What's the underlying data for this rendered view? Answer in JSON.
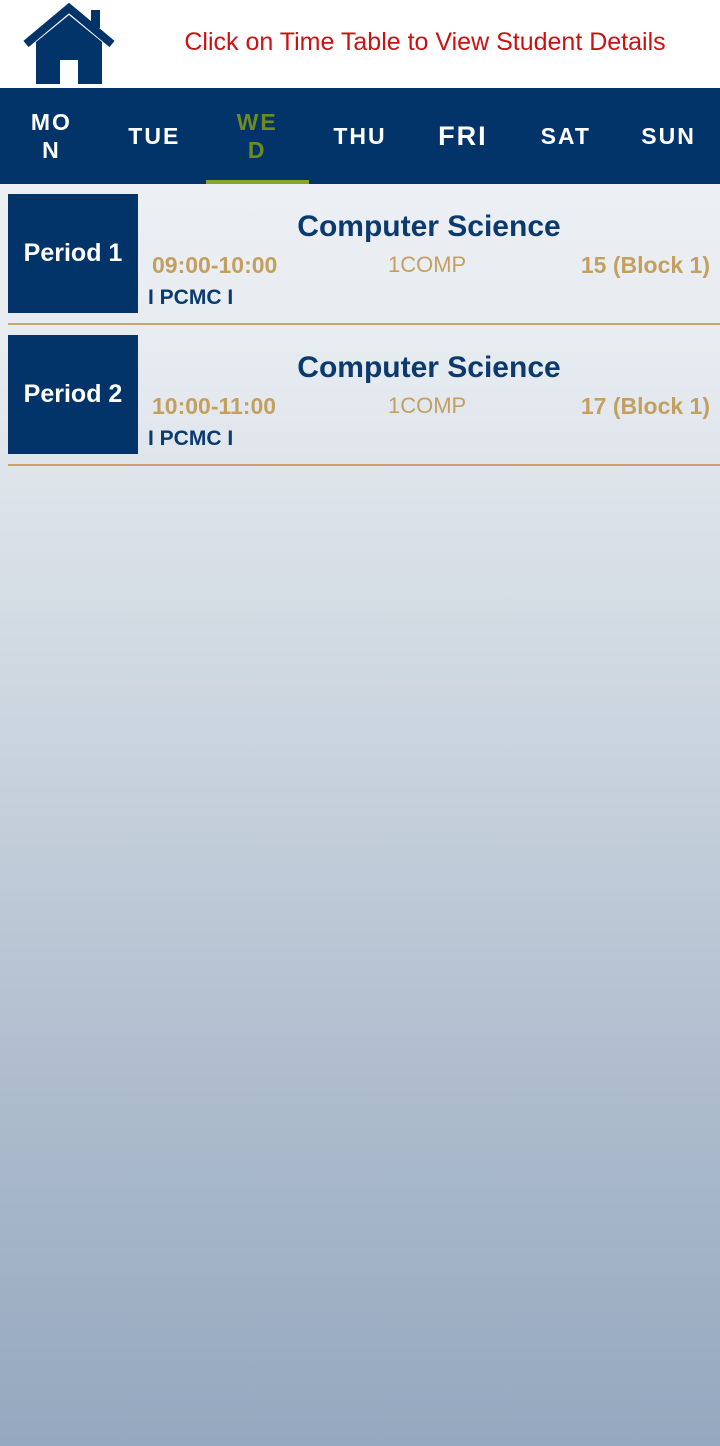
{
  "header": {
    "home_icon": "home-icon",
    "message": "Click on Time Table to View Student Details"
  },
  "tabs": [
    {
      "label": "MON"
    },
    {
      "label": "TUE"
    },
    {
      "label": "WED"
    },
    {
      "label": "THU"
    },
    {
      "label": "FRI"
    },
    {
      "label": "SAT"
    },
    {
      "label": "SUN"
    }
  ],
  "active_tab": "WED",
  "periods": [
    {
      "period": "Period 1",
      "subject": "Computer Science",
      "time": "09:00-10:00",
      "code": "1COMP",
      "room": "15 (Block 1)",
      "section": "I PCMC I"
    },
    {
      "period": "Period 2",
      "subject": "Computer Science",
      "time": "10:00-11:00",
      "code": "1COMP",
      "room": "17 (Block 1)",
      "section": "I PCMC I"
    }
  ],
  "colors": {
    "primary": "#02346a",
    "accent_gold": "#c3a060",
    "active_tab": "#6e8c1e",
    "message_red": "#cc1111"
  }
}
